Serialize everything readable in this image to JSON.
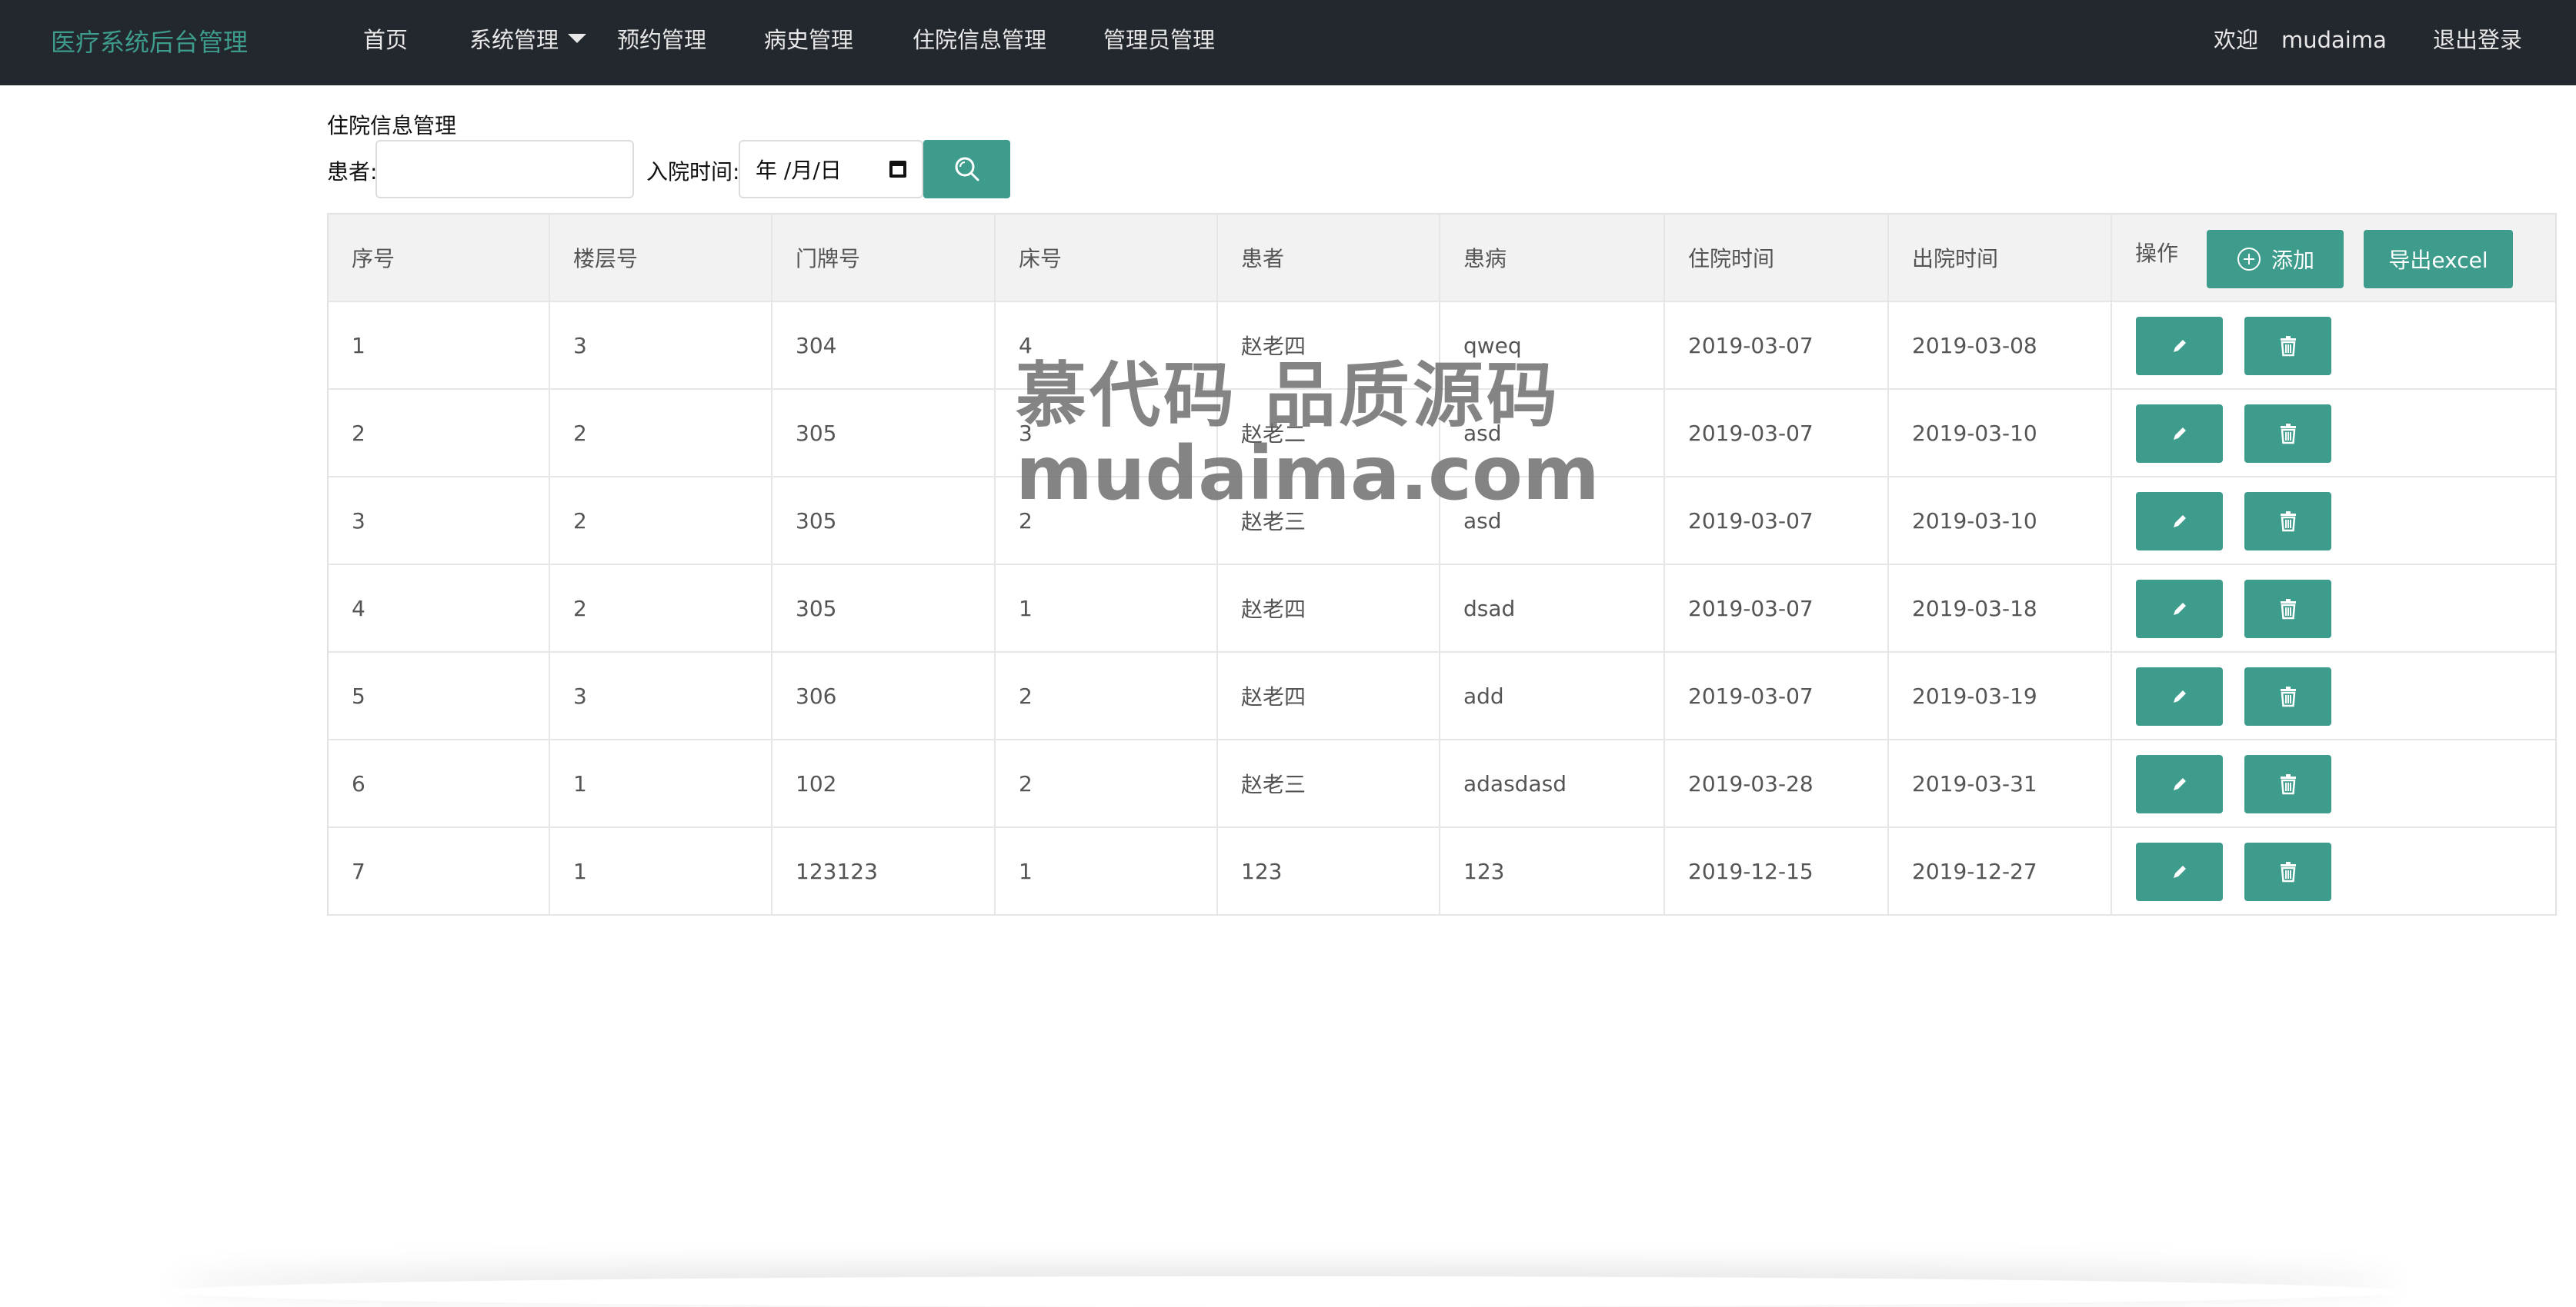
{
  "nav": {
    "brand": "医疗系统后台管理",
    "items": [
      "首页",
      "系统管理",
      "预约管理",
      "病史管理",
      "住院信息管理",
      "管理员管理"
    ],
    "welcome": "欢迎",
    "username": "mudaima",
    "logout": "退出登录"
  },
  "search": {
    "title": "住院信息管理",
    "patient_label": "患者:",
    "patient_value": "",
    "date_label": "入院时间:",
    "date_placeholder": "年 /月/日"
  },
  "table": {
    "headers": [
      "序号",
      "楼层号",
      "门牌号",
      "床号",
      "患者",
      "患病",
      "住院时间",
      "出院时间",
      "操作"
    ],
    "add_label": "添加",
    "export_label": "导出excel",
    "rows": [
      [
        "1",
        "3",
        "304",
        "4",
        "赵老四",
        "qweq",
        "2019-03-07",
        "2019-03-08"
      ],
      [
        "2",
        "2",
        "305",
        "3",
        "赵老二",
        "asd",
        "2019-03-07",
        "2019-03-10"
      ],
      [
        "3",
        "2",
        "305",
        "2",
        "赵老三",
        "asd",
        "2019-03-07",
        "2019-03-10"
      ],
      [
        "4",
        "2",
        "305",
        "1",
        "赵老四",
        "dsad",
        "2019-03-07",
        "2019-03-18"
      ],
      [
        "5",
        "3",
        "306",
        "2",
        "赵老四",
        "add",
        "2019-03-07",
        "2019-03-19"
      ],
      [
        "6",
        "1",
        "102",
        "2",
        "赵老三",
        "adasdasd",
        "2019-03-28",
        "2019-03-31"
      ],
      [
        "7",
        "1",
        "123123",
        "1",
        "123",
        "123",
        "2019-12-15",
        "2019-12-27"
      ]
    ]
  },
  "watermark": {
    "line1": "慕代码 品质源码",
    "line2": "mudaima.com"
  },
  "colors": {
    "navbar": "#23272e",
    "accent": "#3e9c8c",
    "header_row": "#f2f2f2"
  },
  "icons": {
    "search": "search-icon",
    "add": "plus-circle-icon",
    "edit": "pencil-icon",
    "delete": "trash-icon",
    "date": "calendar-icon"
  }
}
